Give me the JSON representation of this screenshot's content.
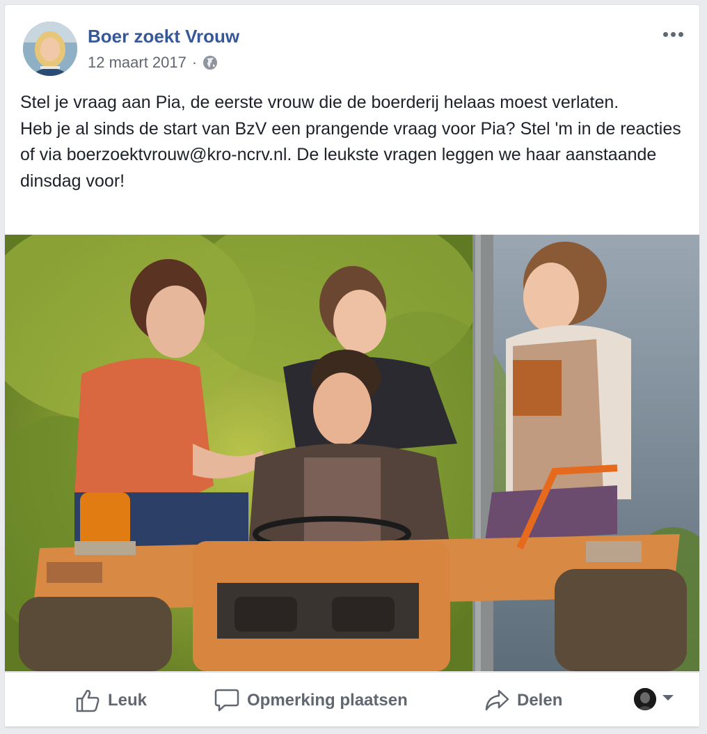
{
  "post": {
    "page_name": "Boer zoekt Vrouw",
    "date": "12 maart 2017",
    "separator": "·",
    "privacy_icon": "globe-icon",
    "more_icon": "more-options-icon",
    "text_lines": [
      "Stel je vraag aan Pia, de eerste vrouw die de boerderij helaas moest verlaten.",
      "Heb je al sinds de start van BzV een prangende vraag voor Pia? Stel 'm in de reacties of via boerzoektvrouw@kro-ncrv.nl. De leukste vragen leggen we haar aanstaande dinsdag voor!"
    ],
    "photo_icon": "post-photo"
  },
  "actions": {
    "like_label": "Leuk",
    "like_icon": "thumbs-up-icon",
    "comment_label": "Opmerking plaatsen",
    "comment_icon": "comment-icon",
    "share_label": "Delen",
    "share_icon": "share-arrow-icon",
    "audience_icon": "chevron-down-icon"
  },
  "colors": {
    "link": "#365899",
    "text": "#1d2129",
    "muted": "#606770",
    "background": "#e9ebee"
  }
}
